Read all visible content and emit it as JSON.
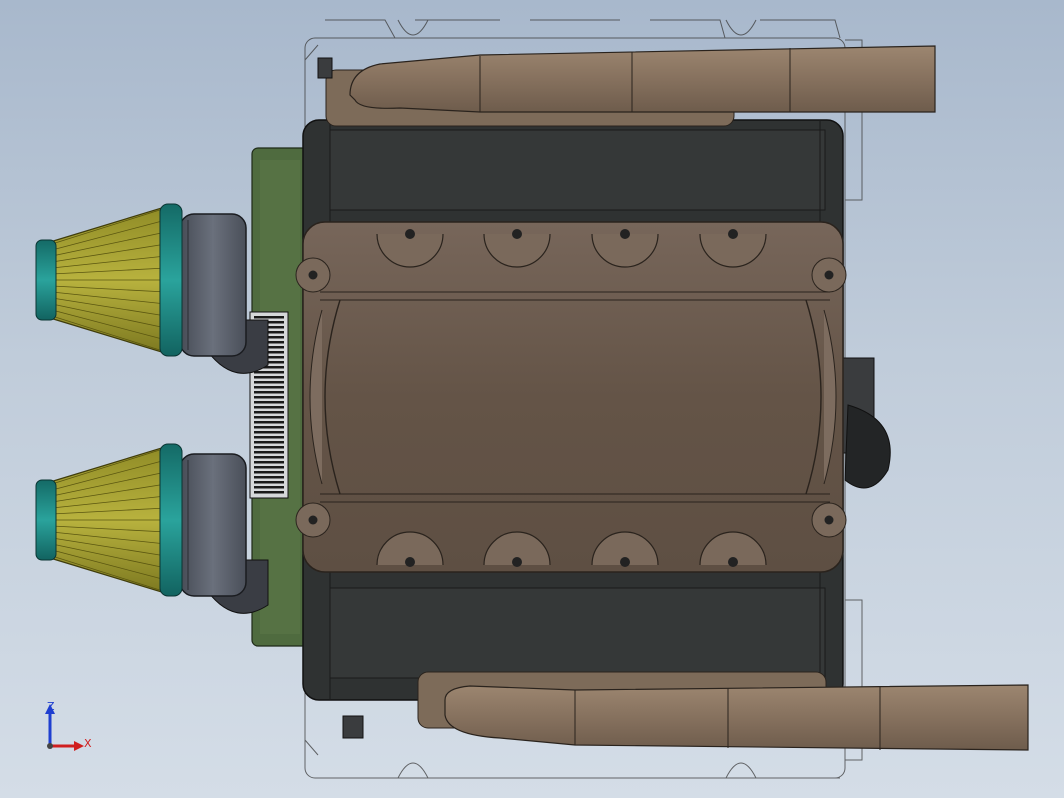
{
  "viewport": {
    "background_top": "#a8b8cc",
    "background_bottom": "#d4dde7"
  },
  "model": {
    "colors": {
      "block": "#2f3232",
      "head": "#6a5a4c",
      "exhaust": "#8a7561",
      "intake_filter": "#a8a332",
      "filter_cap": "#1f8c86",
      "manifold": "#4f6b3f",
      "throttle_body": "#555b66",
      "wireframe": "#3a3a3a"
    }
  },
  "triad": {
    "z_label": "Z",
    "x_label": "X",
    "z_color": "#1f3fd0",
    "x_color": "#d01f1f"
  }
}
